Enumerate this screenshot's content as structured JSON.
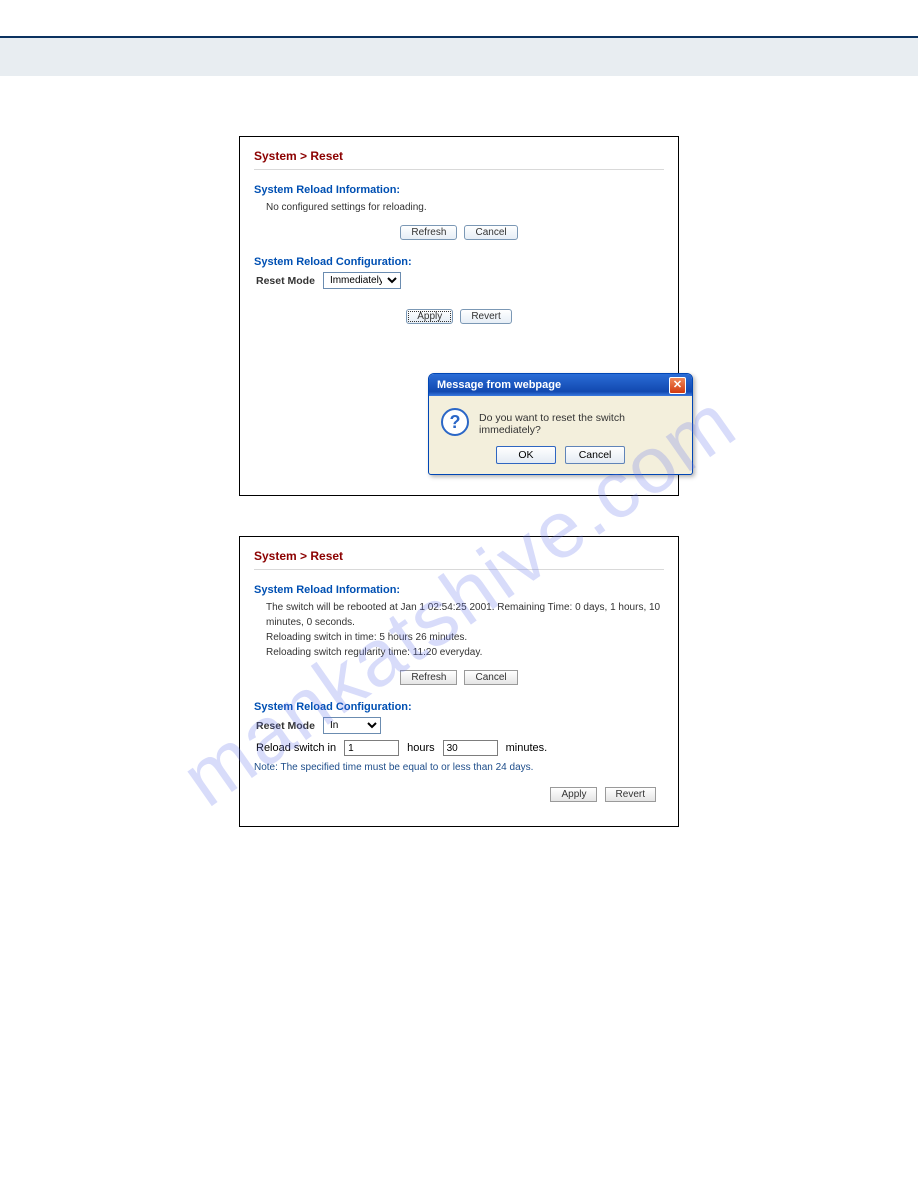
{
  "header": {},
  "watermark": "mankatshive.com",
  "panel1": {
    "breadcrumb": "System > Reset",
    "reload_info": {
      "title": "System Reload Information:",
      "text": "No configured settings for reloading."
    },
    "refresh_btn": "Refresh",
    "cancel_btn": "Cancel",
    "reload_config": {
      "title": "System Reload Configuration:",
      "reset_mode_label": "Reset Mode",
      "reset_mode_value": "Immediately"
    },
    "apply_btn": "Apply",
    "revert_btn": "Revert",
    "dialog": {
      "title": "Message from webpage",
      "message": "Do you want to reset the switch immediately?",
      "ok": "OK",
      "cancel": "Cancel"
    }
  },
  "panel2": {
    "breadcrumb": "System > Reset",
    "reload_info": {
      "title": "System Reload Information:",
      "line1": "The switch will be rebooted at Jan 1 02:54:25 2001. Remaining Time: 0 days, 1 hours, 10 minutes, 0 seconds.",
      "line2": "Reloading switch in time: 5 hours 26 minutes.",
      "line3": "Reloading switch regularity time: 11:20 everyday."
    },
    "refresh_btn": "Refresh",
    "cancel_btn": "Cancel",
    "reload_config": {
      "title": "System Reload Configuration:",
      "reset_mode_label": "Reset Mode",
      "reset_mode_value": "In",
      "prefix": "Reload switch in",
      "hours_value": "1",
      "hours_label": "hours",
      "minutes_value": "30",
      "minutes_label": "minutes.",
      "note": "Note: The specified time must be equal to or less than 24 days."
    },
    "apply_btn": "Apply",
    "revert_btn": "Revert"
  }
}
